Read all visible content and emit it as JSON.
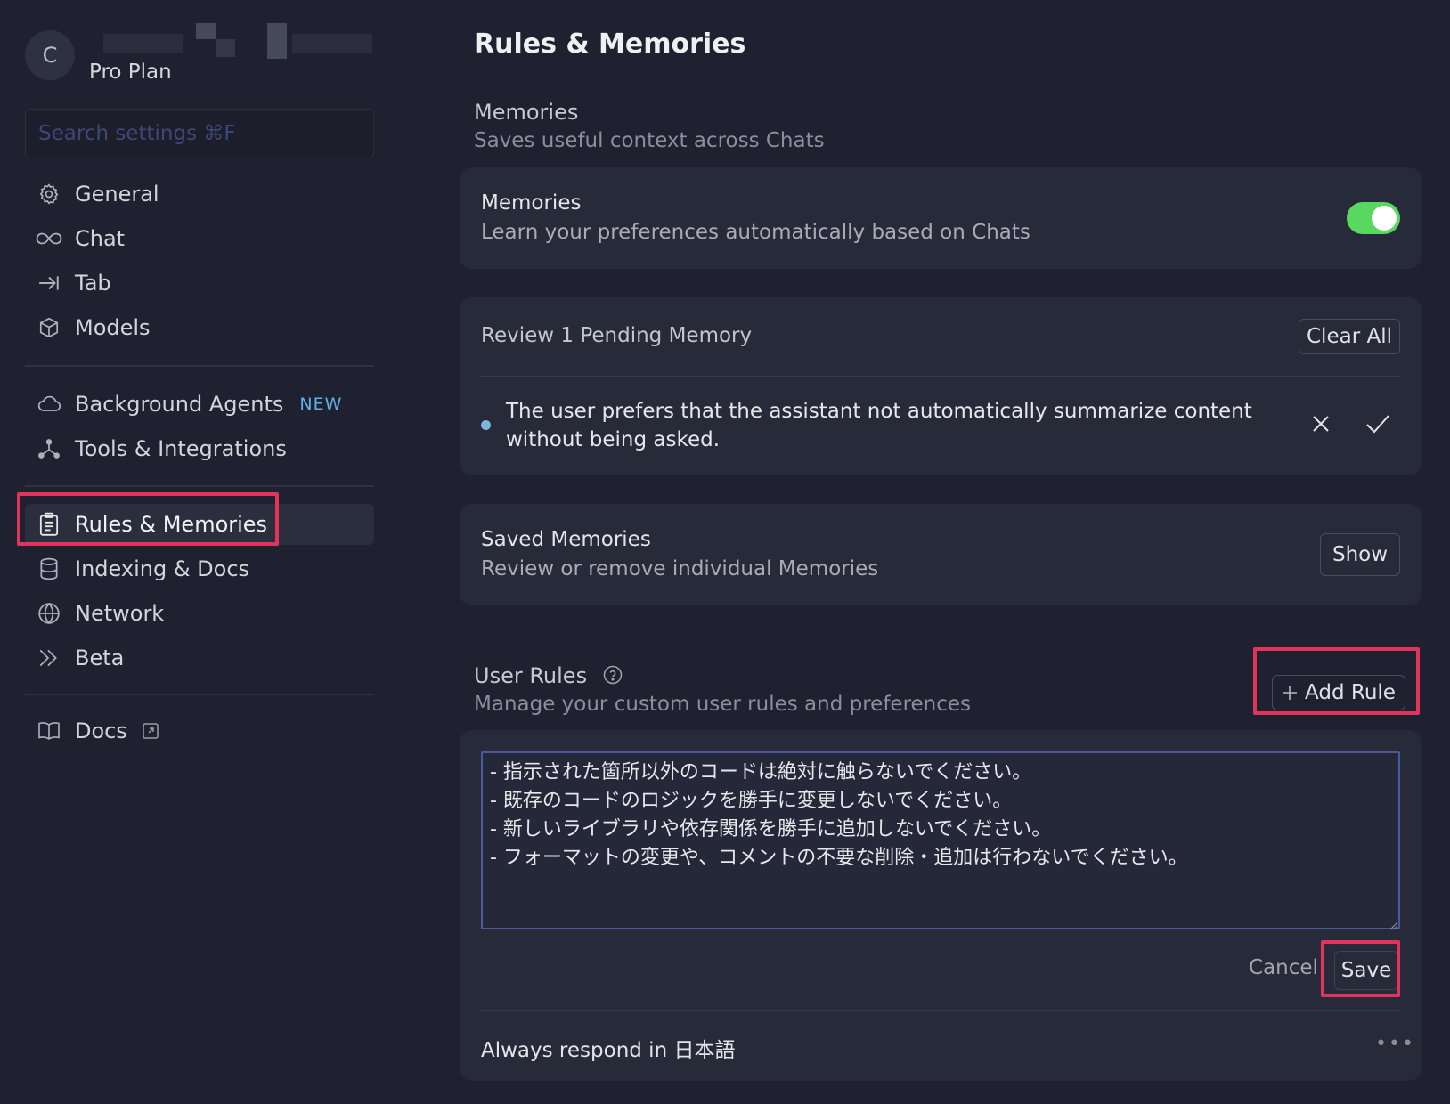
{
  "sidebar": {
    "avatar_letter": "C",
    "plan": "Pro Plan",
    "search_placeholder": "Search settings ⌘F",
    "items": [
      {
        "label": "General",
        "icon": "gear-icon"
      },
      {
        "label": "Chat",
        "icon": "infinity-icon"
      },
      {
        "label": "Tab",
        "icon": "arrow-right-bar-icon"
      },
      {
        "label": "Models",
        "icon": "cube-icon"
      },
      {
        "label": "Background Agents",
        "icon": "cloud-icon",
        "badge": "NEW"
      },
      {
        "label": "Tools & Integrations",
        "icon": "network-icon"
      },
      {
        "label": "Rules & Memories",
        "icon": "clipboard-icon",
        "active": true
      },
      {
        "label": "Indexing & Docs",
        "icon": "database-icon"
      },
      {
        "label": "Network",
        "icon": "globe-icon"
      },
      {
        "label": "Beta",
        "icon": "double-chevron-icon"
      },
      {
        "label": "Docs",
        "icon": "book-icon"
      }
    ]
  },
  "main": {
    "title": "Rules & Memories",
    "memories_section": {
      "title": "Memories",
      "subtitle": "Saves useful context across Chats"
    },
    "memories_card": {
      "title": "Memories",
      "subtitle": "Learn your preferences automatically based on Chats",
      "toggle_on": true
    },
    "pending_card": {
      "title": "Review 1 Pending Memory",
      "clear_label": "Clear All",
      "memory_line1": "The user prefers that the assistant not automatically summarize content",
      "memory_line2": "without being asked."
    },
    "saved_card": {
      "title": "Saved Memories",
      "subtitle": "Review or remove individual Memories",
      "show_label": "Show"
    },
    "user_rules": {
      "title": "User Rules",
      "subtitle": "Manage your custom user rules and preferences",
      "add_label": "Add Rule",
      "rules_text": "- 指示された箇所以外のコードは絶対に触らないでください。\n- 既存のコードのロジックを勝手に変更しないでください。\n- 新しいライブラリや依存関係を勝手に追加しないでください。\n- フォーマットの変更や、コメントの不要な削除・追加は行わないでください。",
      "cancel_label": "Cancel",
      "save_label": "Save",
      "rule_item": "Always respond in 日本語"
    }
  },
  "colors": {
    "background": "#1f2130",
    "card": "#272a39",
    "toggle_on": "#58d85f",
    "highlight": "#e0345c",
    "badge": "#5fb0e8"
  }
}
